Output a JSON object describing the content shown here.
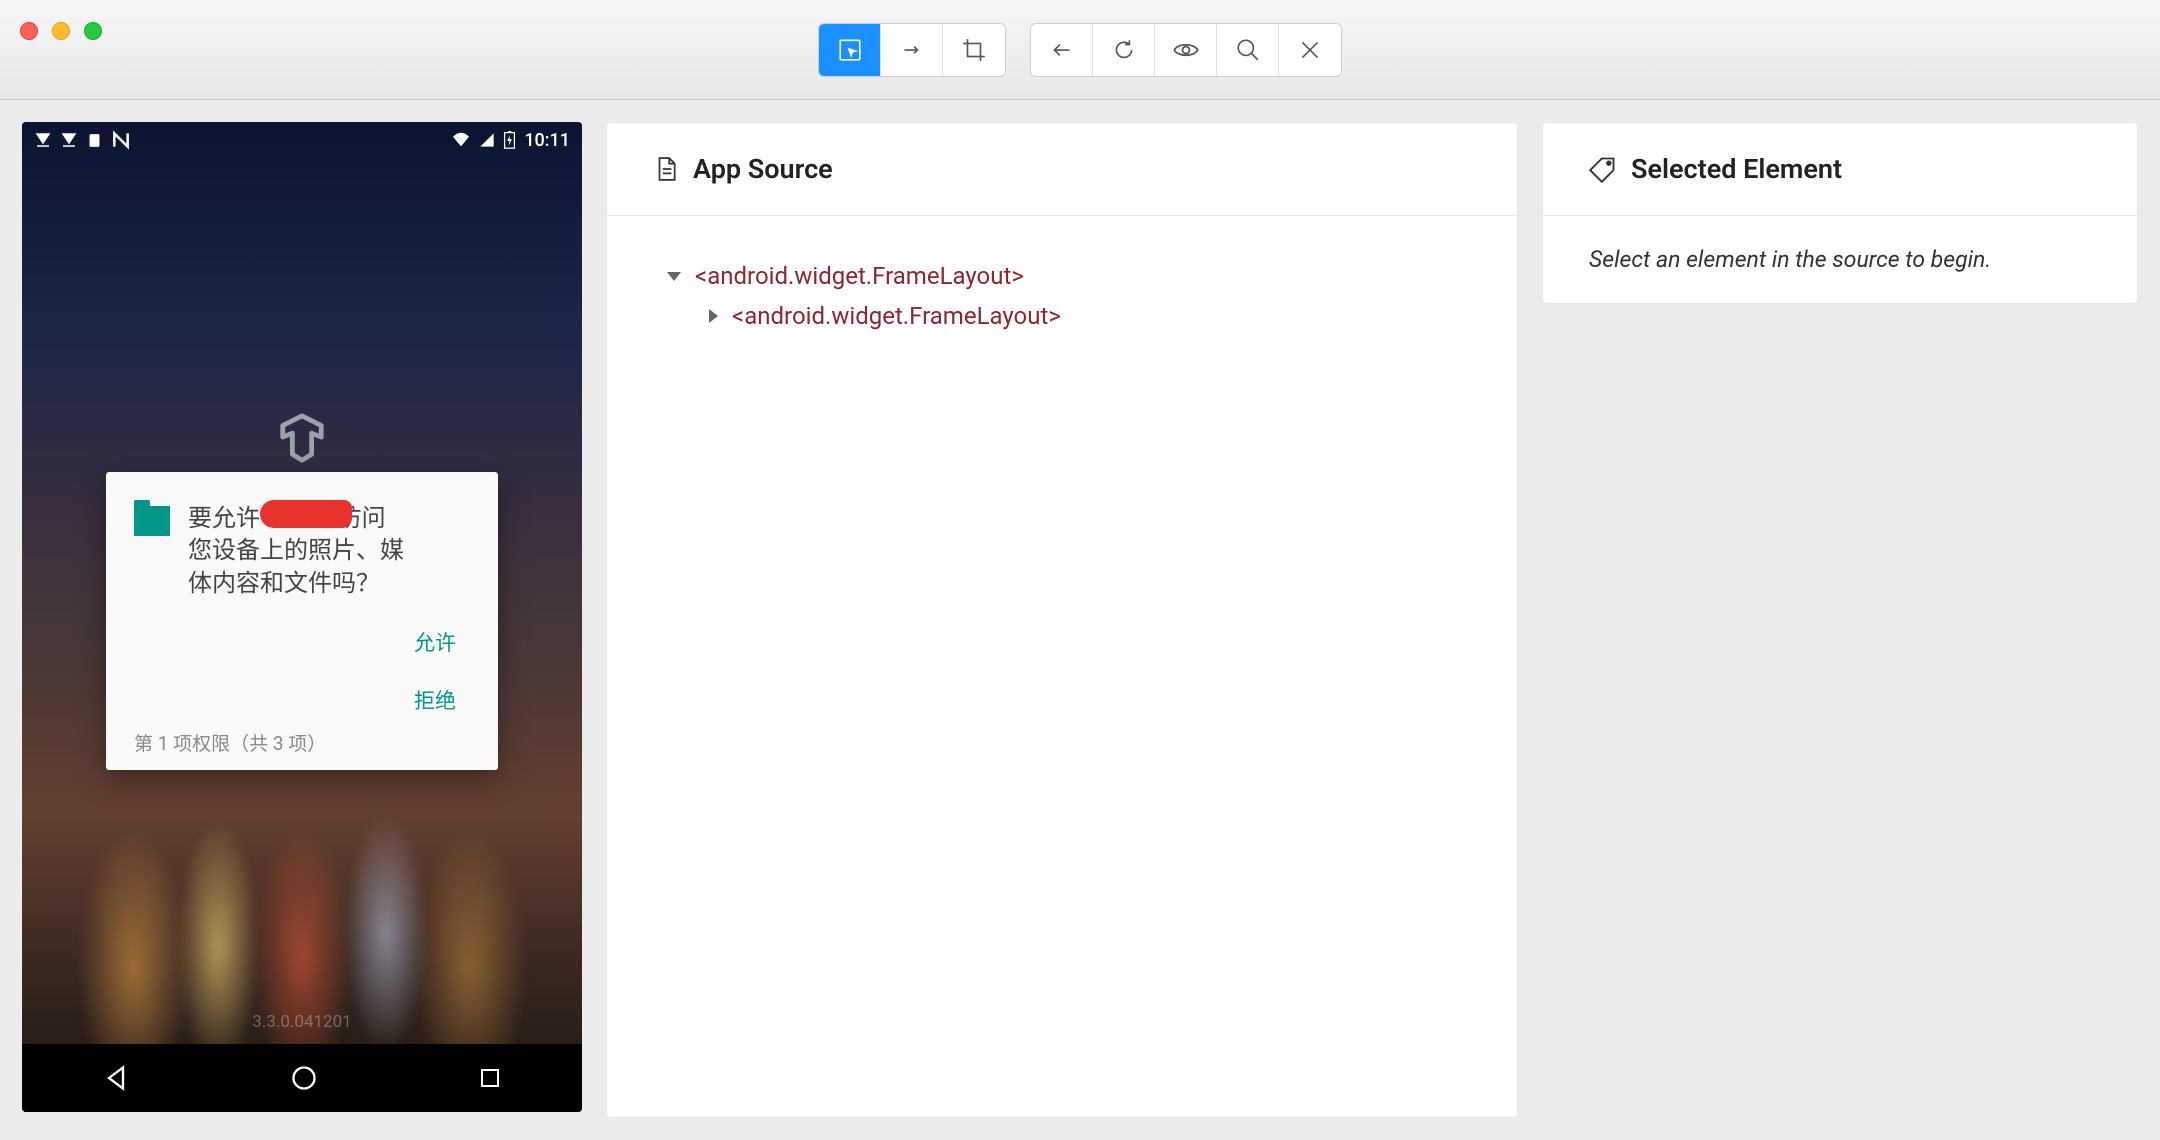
{
  "device": {
    "status_time": "10:11",
    "permission": {
      "text_line1": "要允许",
      "text_line1_b": "动访问",
      "text_line2": "您设备上的照片、媒",
      "text_line3": "体内容和文件吗？",
      "allow": "允许",
      "deny": "拒绝",
      "footer": "第 1 项权限（共 3 项）"
    },
    "version": "3.3.0.041201"
  },
  "source": {
    "title": "App Source",
    "tree": {
      "root": "<android.widget.FrameLayout>",
      "child": "<android.widget.FrameLayout>"
    }
  },
  "selected": {
    "title": "Selected Element",
    "placeholder": "Select an element in the source to begin."
  }
}
